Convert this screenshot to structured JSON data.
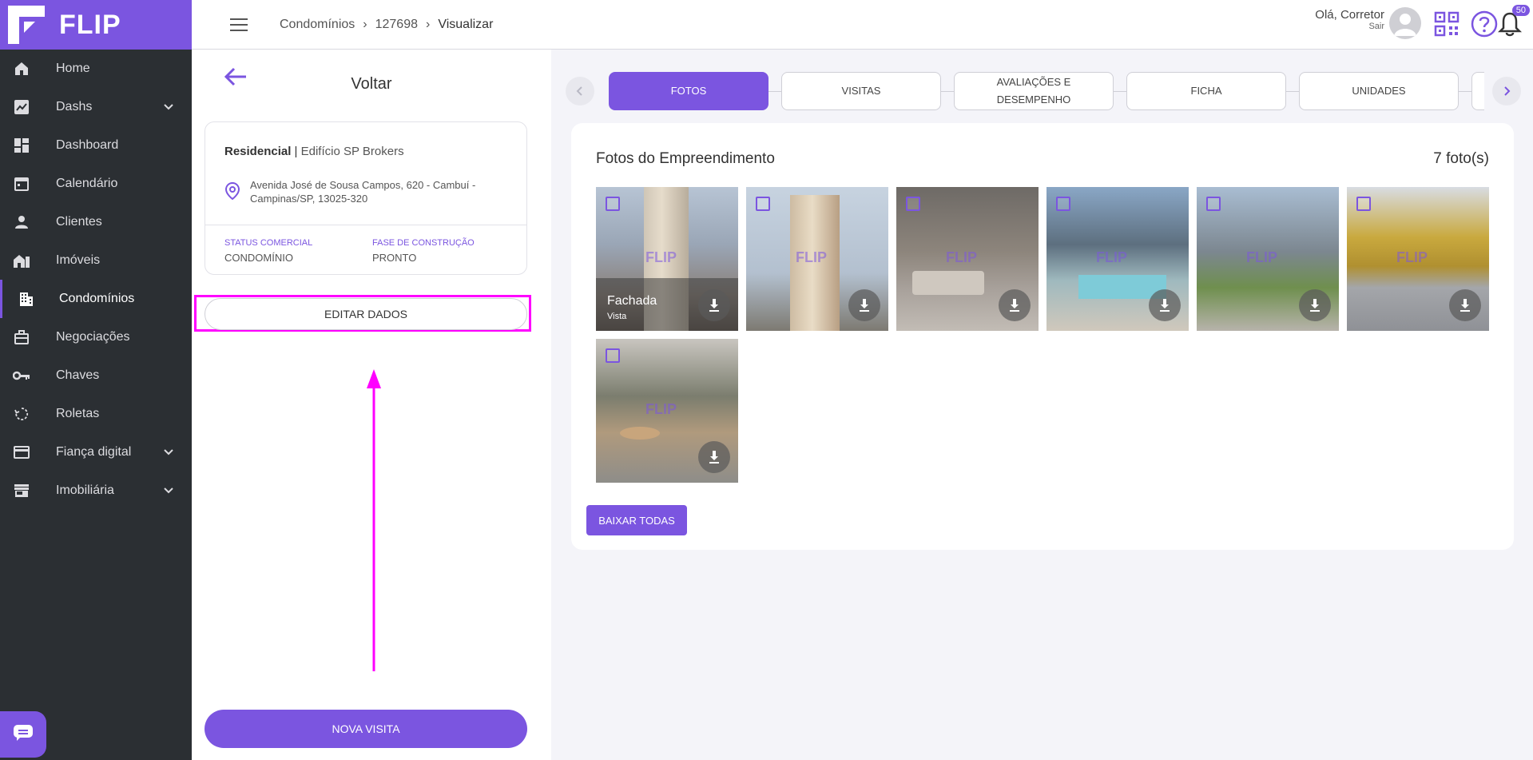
{
  "app": {
    "brand": "FLIP"
  },
  "sidebar": {
    "items": [
      {
        "label": "Home",
        "icon": "home-icon"
      },
      {
        "label": "Dashs",
        "icon": "trending-chart-icon"
      },
      {
        "label": "Dashboard",
        "icon": "dashboard-grid-icon"
      },
      {
        "label": "Calendário",
        "icon": "calendar-icon"
      },
      {
        "label": "Clientes",
        "icon": "person-icon"
      },
      {
        "label": "Imóveis",
        "icon": "house-icon"
      },
      {
        "label": "Condomínios",
        "icon": "building-icon",
        "active": true
      },
      {
        "label": "Negociações",
        "icon": "briefcase-icon"
      },
      {
        "label": "Chaves",
        "icon": "key-icon"
      },
      {
        "label": "Roletas",
        "icon": "roulette-icon"
      },
      {
        "label": "Fiança digital",
        "icon": "credit-card-icon"
      },
      {
        "label": "Imobiliária",
        "icon": "store-icon"
      }
    ]
  },
  "header": {
    "breadcrumb": [
      "Condomínios",
      "127698",
      "Visualizar"
    ],
    "greeting": "Olá, Corretor",
    "logout": "Sair",
    "notification_count": "50"
  },
  "panel": {
    "back_label": "Voltar",
    "type": "Residencial",
    "separator": "|",
    "name": "Edifício SP Brokers",
    "address": "Avenida José de Sousa Campos, 620 - Cambuí - Campinas/SP, 13025-320",
    "status_label": "STATUS COMERCIAL",
    "status_value": "CONDOMÍNIO",
    "phase_label": "FASE DE CONSTRUÇÃO",
    "phase_value": "PRONTO",
    "edit_button": "EDITAR DADOS",
    "new_visit_button": "NOVA VISITA"
  },
  "tabs": [
    {
      "label": "FOTOS",
      "active": true
    },
    {
      "label": "VISITAS"
    },
    {
      "label": "AVALIAÇÕES E DESEMPENHO"
    },
    {
      "label": "FICHA"
    },
    {
      "label": "UNIDADES"
    }
  ],
  "photos": {
    "title": "Fotos do Empreendimento",
    "count": "7 foto(s)",
    "watermark": "FLIP",
    "download_all": "BAIXAR TODAS",
    "items": [
      {
        "caption_title": "Fachada",
        "caption_sub": "Vista"
      },
      {
        "caption_title": "",
        "caption_sub": ""
      },
      {
        "caption_title": "",
        "caption_sub": ""
      },
      {
        "caption_title": "",
        "caption_sub": ""
      },
      {
        "caption_title": "",
        "caption_sub": ""
      },
      {
        "caption_title": "",
        "caption_sub": ""
      },
      {
        "caption_title": "",
        "caption_sub": ""
      }
    ]
  },
  "colors": {
    "accent": "#7b55e0",
    "sidebar_bg": "#2b2f33",
    "highlight": "#ff00ff"
  }
}
